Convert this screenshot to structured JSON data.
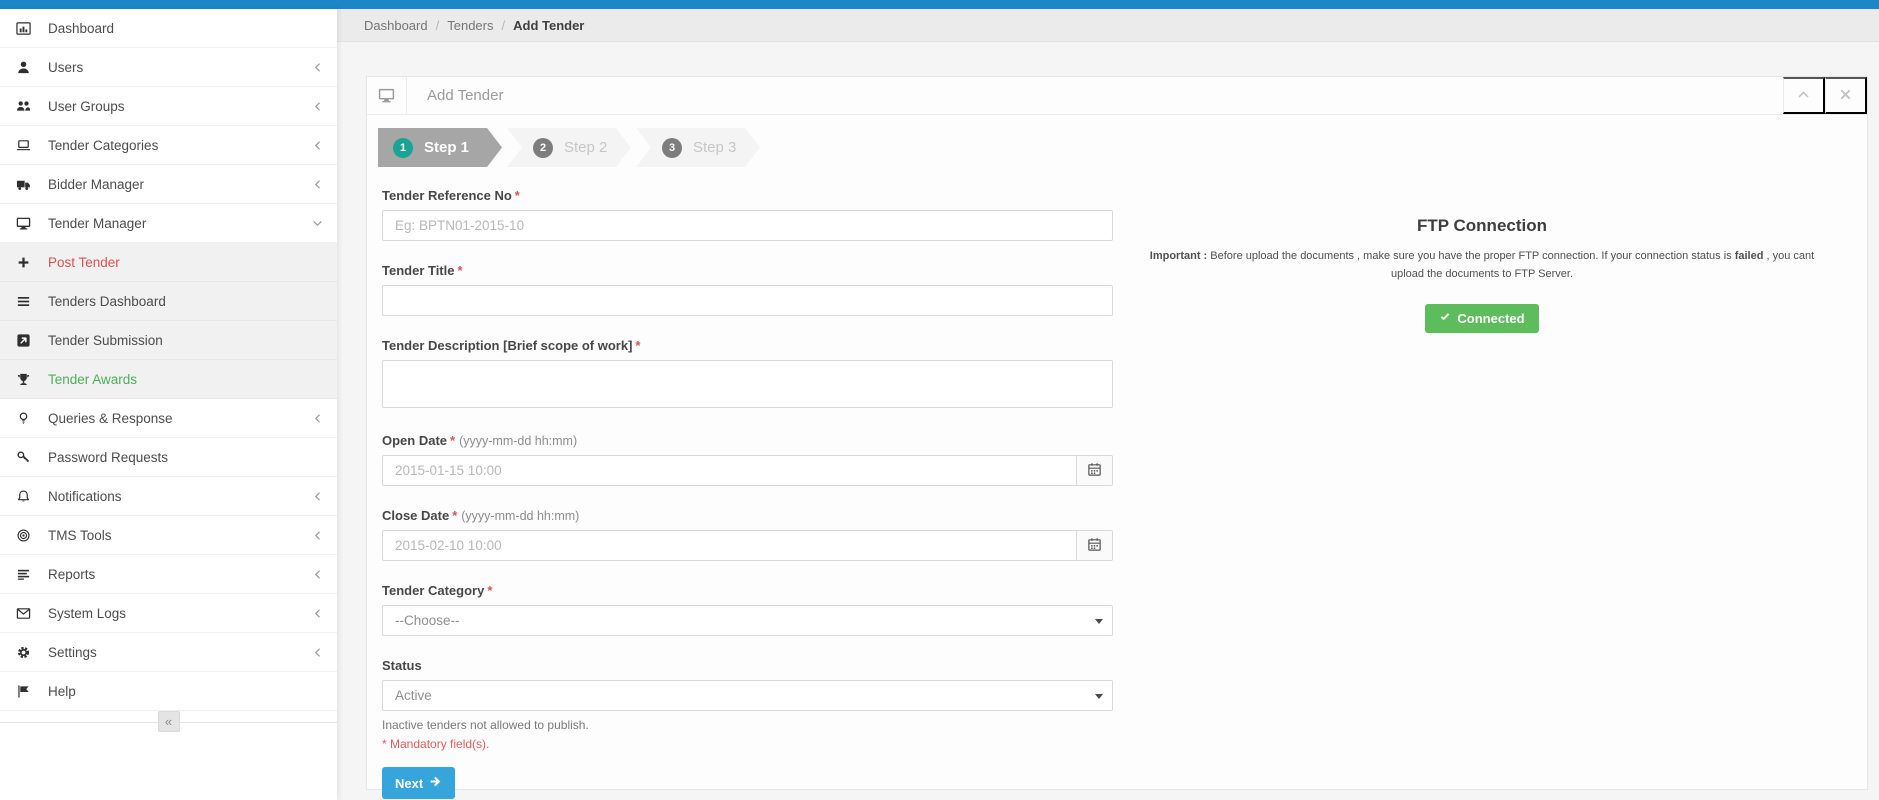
{
  "app": {
    "topbar_color": "#1d86c8"
  },
  "sidebar": {
    "items": [
      {
        "label": "Dashboard",
        "icon": "bar-chart-icon"
      },
      {
        "label": "Users",
        "icon": "user-icon",
        "chevron": "left"
      },
      {
        "label": "User Groups",
        "icon": "users-icon",
        "chevron": "left"
      },
      {
        "label": "Tender Categories",
        "icon": "laptop-icon",
        "chevron": "left"
      },
      {
        "label": "Bidder Manager",
        "icon": "truck-icon",
        "chevron": "left"
      },
      {
        "label": "Tender Manager",
        "icon": "desktop-icon",
        "chevron": "down"
      },
      {
        "label": "Post Tender",
        "icon": "plus-icon",
        "submenu": true,
        "color": "#d9534f"
      },
      {
        "label": "Tenders Dashboard",
        "icon": "list-icon",
        "submenu": true
      },
      {
        "label": "Tender Submission",
        "icon": "share-square-icon",
        "submenu": true
      },
      {
        "label": "Tender Awards",
        "icon": "trophy-icon",
        "submenu": true,
        "color": "#4eb058"
      },
      {
        "label": "Queries & Response",
        "icon": "lightbulb-icon",
        "chevron": "left"
      },
      {
        "label": "Password Requests",
        "icon": "key-icon"
      },
      {
        "label": "Notifications",
        "icon": "bell-icon",
        "chevron": "left"
      },
      {
        "label": "TMS Tools",
        "icon": "bullseye-icon",
        "chevron": "left"
      },
      {
        "label": "Reports",
        "icon": "report-lines-icon",
        "chevron": "left"
      },
      {
        "label": "System Logs",
        "icon": "envelope-icon",
        "chevron": "left"
      },
      {
        "label": "Settings",
        "icon": "gear-icon",
        "chevron": "left"
      },
      {
        "label": "Help",
        "icon": "flag-icon"
      }
    ],
    "collapse_glyph": "«"
  },
  "breadcrumb": [
    "Dashboard",
    "Tenders",
    "Add Tender"
  ],
  "panel": {
    "title": "Add Tender",
    "steps": [
      {
        "num": "1",
        "label": "Step 1",
        "active": true
      },
      {
        "num": "2",
        "label": "Step 2",
        "active": false
      },
      {
        "num": "3",
        "label": "Step 3",
        "active": false
      }
    ],
    "form": {
      "required_marker": "*",
      "reference_label": "Tender Reference No",
      "reference_placeholder": "Eg: BPTN01-2015-10",
      "title_label": "Tender Title",
      "description_label": "Tender Description [Brief scope of work]",
      "open_date_label": "Open Date",
      "open_date_hint": "(yyyy-mm-dd hh:mm)",
      "open_date_placeholder": "2015-01-15 10:00",
      "close_date_label": "Close Date",
      "close_date_hint": "(yyyy-mm-dd hh:mm)",
      "close_date_placeholder": "2015-02-10 10:00",
      "category_label": "Tender Category",
      "category_value": "--Choose--",
      "status_label": "Status",
      "status_value": "Active",
      "status_help": "Inactive tenders not allowed to publish.",
      "mandatory_note": "* Mandatory field(s).",
      "next_label": "Next"
    },
    "ftp": {
      "title": "FTP Connection",
      "note_bold_prefix": "Important :",
      "note_part1": " Before upload the documents , make sure you have the proper FTP connection. If your connection status is ",
      "note_bold_mid": "failed",
      "note_part2": " , you cant upload the documents to FTP Server.",
      "status_button": "Connected"
    }
  },
  "colors": {
    "accent_blue": "#35a5dc",
    "success_green": "#5dbd5d",
    "danger_red": "#d9534f",
    "step_active_teal": "#1ba496"
  }
}
